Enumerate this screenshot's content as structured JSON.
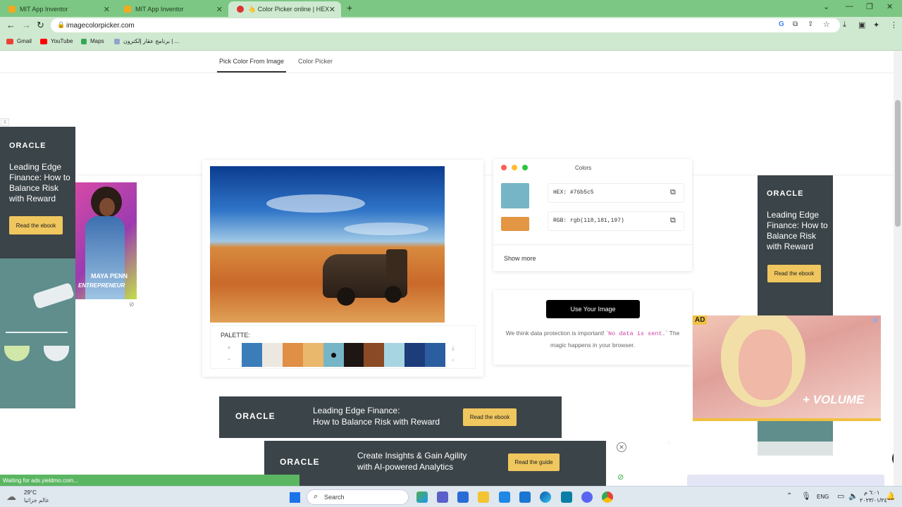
{
  "browser": {
    "tabs": [
      {
        "title": "MIT App Inventor"
      },
      {
        "title": "MIT App Inventor"
      },
      {
        "title": "👆 Color Picker online | HEX Co"
      }
    ],
    "url": "imagecolorpicker.com",
    "bookmarks": [
      {
        "label": "Gmail"
      },
      {
        "label": "YouTube"
      },
      {
        "label": "Maps"
      },
      {
        "label": "برنامج عقار إلكترون | ..."
      }
    ],
    "status": "Waiting for ads.yieldmo.com..."
  },
  "page": {
    "tabs": [
      {
        "label": "Pick Color From Image"
      },
      {
        "label": "Color Picker"
      }
    ],
    "palette": {
      "label": "PALETTE:",
      "colors": [
        "#3b7db8",
        "#ece8e0",
        "#e08f46",
        "#e9b86d",
        "#76b5c5",
        "#1e1612",
        "#8a4a25",
        "#a8d5e2",
        "#1d3c7a",
        "#2b5ea0"
      ],
      "selected_index": 4,
      "plus": "+",
      "minus": "−"
    },
    "colors_panel": {
      "title": "Colors",
      "swatch_primary": "#76b5c5",
      "swatch_secondary": "#e39644",
      "hex_text": "HEX: #76b5c5",
      "rgb_text": "RGB: rgb(118,181,197)",
      "show_more": "Show more"
    },
    "upload": {
      "button": "Use Your Image",
      "note_prefix": "We think data protection is important! `",
      "note_code": "No data is sent.",
      "note_suffix": "` The magic happens in your browser."
    },
    "ads": {
      "left": {
        "brand": "ORACLE",
        "headline": "Leading Edge Finance: How to Balance Risk with Reward",
        "cta": "Read the ebook"
      },
      "left_mini": {
        "text1": "MAYA PENN",
        "text2": "ENTREPRENEUR"
      },
      "right": {
        "brand": "ORACLE",
        "headline": "Leading Edge Finance: How to Balance Risk with Reward",
        "cta": "Read the ebook"
      },
      "video": {
        "badge": "AD",
        "caption": "+ VOLUME"
      },
      "banner1": {
        "brand": "ORACLE",
        "headline1": "Leading Edge Finance:",
        "headline2": "How to Balance Risk with Reward",
        "cta": "Read the ebook"
      },
      "banner2": {
        "brand": "ORACLE",
        "headline1": "Create Insights & Gain Agility",
        "headline2": "with AI-powered Analytics",
        "cta": "Read the guide"
      },
      "close_x": "X"
    }
  },
  "taskbar": {
    "weather_temp": "29°C",
    "weather_desc": "عالم جزائيا",
    "search": "Search",
    "lang": "ENG",
    "time": "٦:٠١ م",
    "date": "٢٠٢٣/٠١/٢٤"
  },
  "colors": {
    "chrome_green": "#7cc783",
    "toolbar_green": "#cfe8d0",
    "oracle_dark": "#3b4448",
    "cta_yellow": "#f0c75e"
  }
}
